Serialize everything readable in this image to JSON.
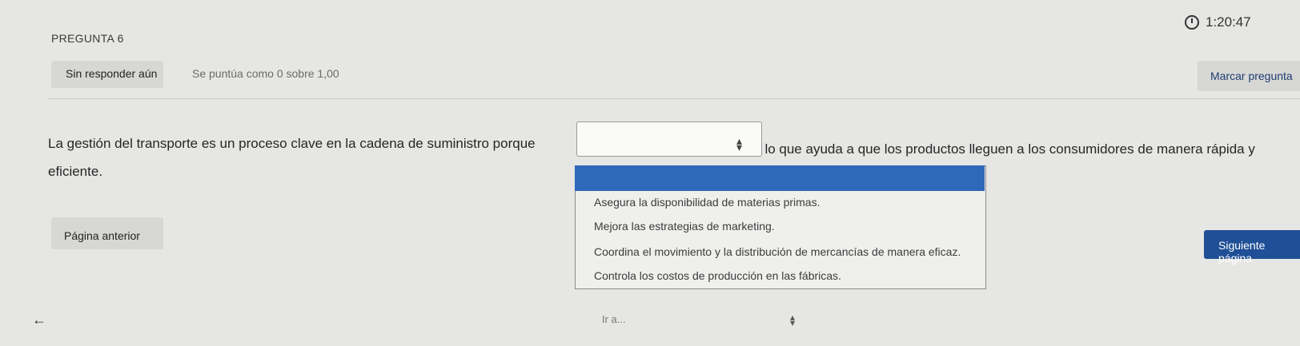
{
  "header": {
    "timer": "1:20:47",
    "question_title": "PREGUNTA 6",
    "status": "Sin responder aún",
    "grade": "Se puntúa como 0 sobre 1,00",
    "flag_label": "Marcar pregunta"
  },
  "question": {
    "text_before": "La gestión del transporte es un proceso clave en la cadena de suministro porque",
    "text_after": ", lo que ayuda a que los productos lleguen a los consumidores de manera rápida y",
    "text_end": "eficiente.",
    "select_value": "",
    "options": [
      "Asegura la disponibilidad de materias primas.",
      "Mejora las estrategias de marketing.",
      "Coordina el movimiento y la distribución de mercancías de manera eficaz.",
      "Controla los costos de producción en las fábricas."
    ]
  },
  "navigation": {
    "prev_label": "Página anterior",
    "next_label": "Siguiente página",
    "back_arrow": "←",
    "goto_label": "Ir a..."
  },
  "colors": {
    "accent": "#2f68b8",
    "next_button": "#1f4f96",
    "flag_text": "#1f3f70"
  },
  "icons": {
    "timer": "clock-icon",
    "select": "updown-arrows-icon",
    "back": "arrow-left-icon"
  }
}
